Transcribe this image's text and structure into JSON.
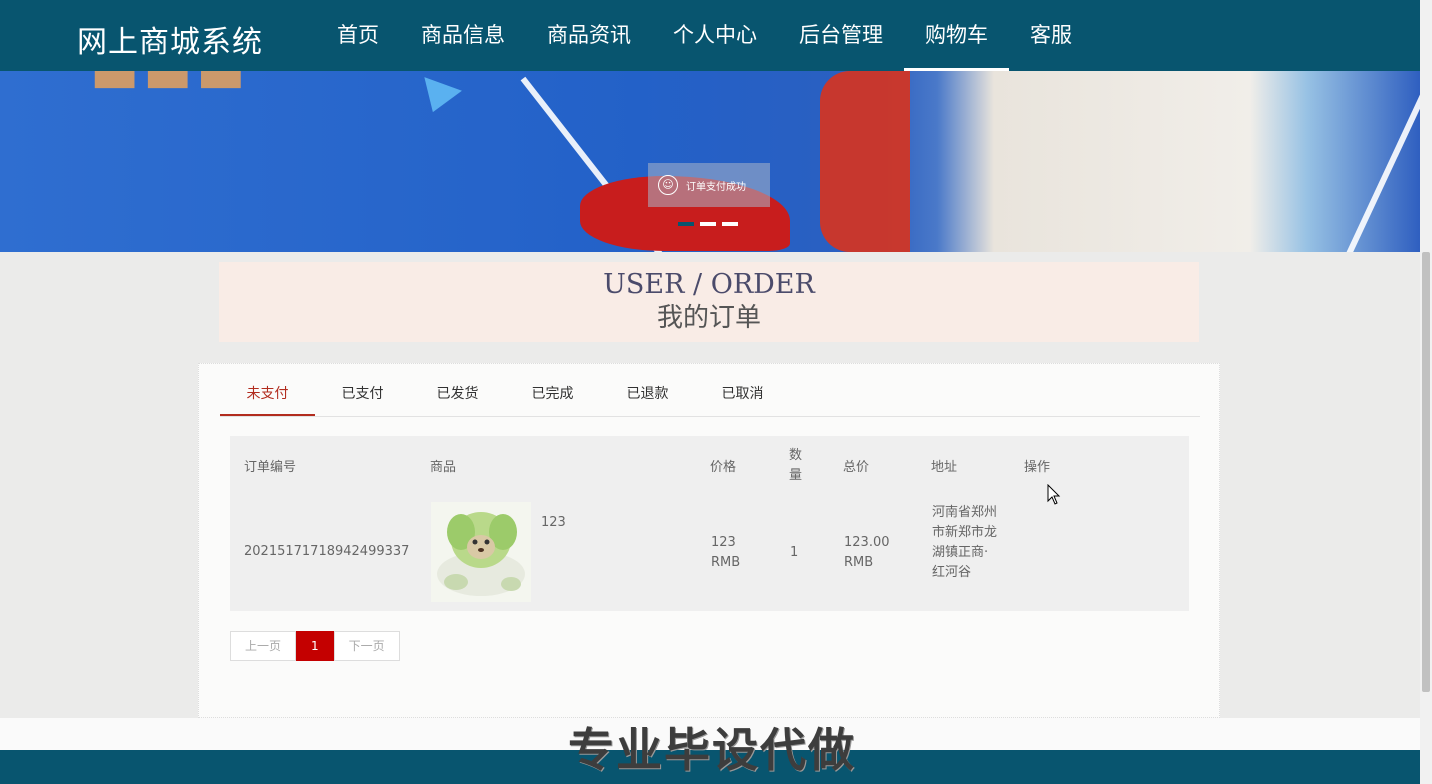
{
  "header": {
    "brand": "网上商城系统",
    "nav": [
      {
        "label": "首页"
      },
      {
        "label": "商品信息"
      },
      {
        "label": "商品资讯"
      },
      {
        "label": "个人中心"
      },
      {
        "label": "后台管理"
      },
      {
        "label": "购物车",
        "active": true
      },
      {
        "label": "客服"
      }
    ]
  },
  "banner": {
    "toast_text": "订单支付成功",
    "slide_index": 1,
    "slide_count": 3
  },
  "page_title": {
    "en": "USER / ORDER",
    "zh": "我的订单"
  },
  "tabs": [
    {
      "label": "未支付",
      "active": true
    },
    {
      "label": "已支付"
    },
    {
      "label": "已发货"
    },
    {
      "label": "已完成"
    },
    {
      "label": "已退款"
    },
    {
      "label": "已取消"
    }
  ],
  "table": {
    "headers": {
      "order_no": "订单编号",
      "product": "商品",
      "price": "价格",
      "qty": "数量",
      "total": "总价",
      "address": "地址",
      "action": "操作"
    },
    "rows": [
      {
        "order_no": "20215171718942499337",
        "product_name": "123",
        "product_image": "product-image",
        "price": "123 RMB",
        "qty": "1",
        "total": "123.00 RMB",
        "address": "河南省郑州市新郑市龙湖镇正商·红河谷",
        "action": ""
      }
    ]
  },
  "pagination": {
    "prev": "上一页",
    "current": "1",
    "next": "下一页"
  },
  "footer": {
    "watermark": "专业毕设代做"
  },
  "colors": {
    "nav_bg": "#08556f",
    "accent": "#b22c1e",
    "pager_active": "#c40000"
  }
}
